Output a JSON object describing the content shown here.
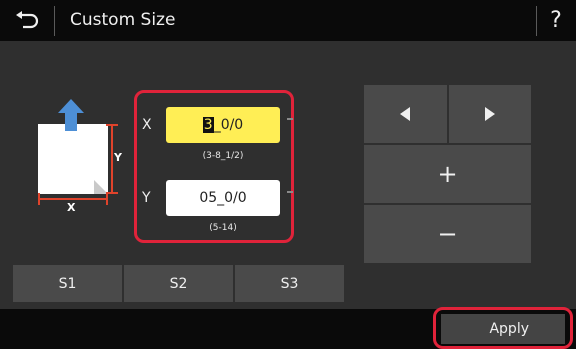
{
  "header": {
    "title": "Custom Size",
    "back_icon": "back-arrow-icon",
    "help_label": "?"
  },
  "illustration": {
    "x_label": "X",
    "y_label": "Y"
  },
  "inputs": {
    "x": {
      "label": "X",
      "cursor_char": "3",
      "value_rest": "_0/0",
      "range": "(3-8_1/2)"
    },
    "y": {
      "label": "Y",
      "value": "05_0/0",
      "range": "(5-14)"
    }
  },
  "keypad": {
    "left_icon": "triangle-left-icon",
    "right_icon": "triangle-right-icon",
    "plus_label": "+",
    "minus_label": "−"
  },
  "presets": [
    "S1",
    "S2",
    "S3"
  ],
  "footer": {
    "apply_label": "Apply"
  },
  "colors": {
    "highlight_red": "#e0233a",
    "active_field": "#ffee55",
    "dimension_red": "#e0432b",
    "arrow_blue": "#4d8fd6"
  }
}
